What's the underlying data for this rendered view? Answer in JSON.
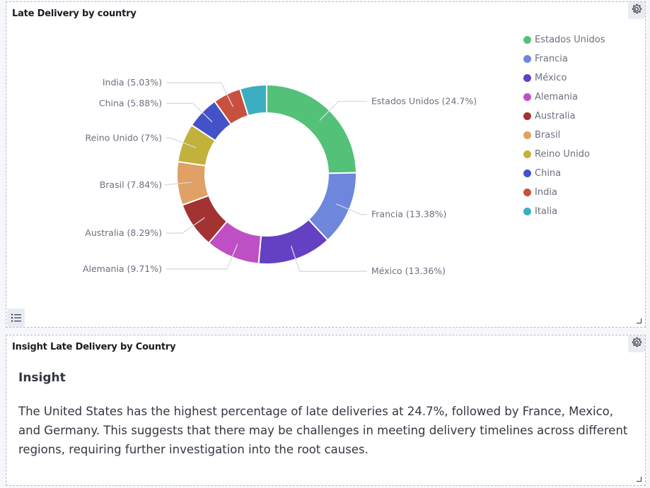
{
  "panels": {
    "chart_title": "Late Delivery by country",
    "insight_title": "Insight Late Delivery by Country"
  },
  "icons": {
    "settings": "gear-icon",
    "legend_toggle": "list-icon",
    "resize": "resize-corner-icon"
  },
  "chart_data": {
    "type": "pie",
    "donut": true,
    "title": "Late Delivery by country",
    "legend_position": "right",
    "categories": [
      "Estados Unidos",
      "Francia",
      "México",
      "Alemania",
      "Australia",
      "Brasil",
      "Reino Unido",
      "China",
      "India",
      "Italia"
    ],
    "values": [
      24.7,
      13.38,
      13.36,
      9.71,
      8.29,
      7.84,
      7.0,
      5.88,
      5.03,
      4.81
    ],
    "labels": [
      "Estados Unidos (24.7%)",
      "Francia (13.38%)",
      "México (13.36%)",
      "Alemania (9.71%)",
      "Australia (8.29%)",
      "Brasil (7.84%)",
      "Reino Unido (7%)",
      "China (5.88%)",
      "India (5.03%)",
      null
    ],
    "colors": [
      "#54c178",
      "#6e87dd",
      "#6440c3",
      "#bf4fc4",
      "#a33232",
      "#e0a066",
      "#c2b13a",
      "#4452c7",
      "#c9503f",
      "#3caec1"
    ]
  },
  "legend": [
    "Estados Unidos",
    "Francia",
    "México",
    "Alemania",
    "Australia",
    "Brasil",
    "Reino Unido",
    "China",
    "India",
    "Italia"
  ],
  "insight": {
    "heading": "Insight",
    "body": "The United States has the highest percentage of late deliveries at 24.7%, followed by France, Mexico, and Germany. This suggests that there may be challenges in meeting delivery timelines across different regions, requiring further investigation into the root causes."
  }
}
